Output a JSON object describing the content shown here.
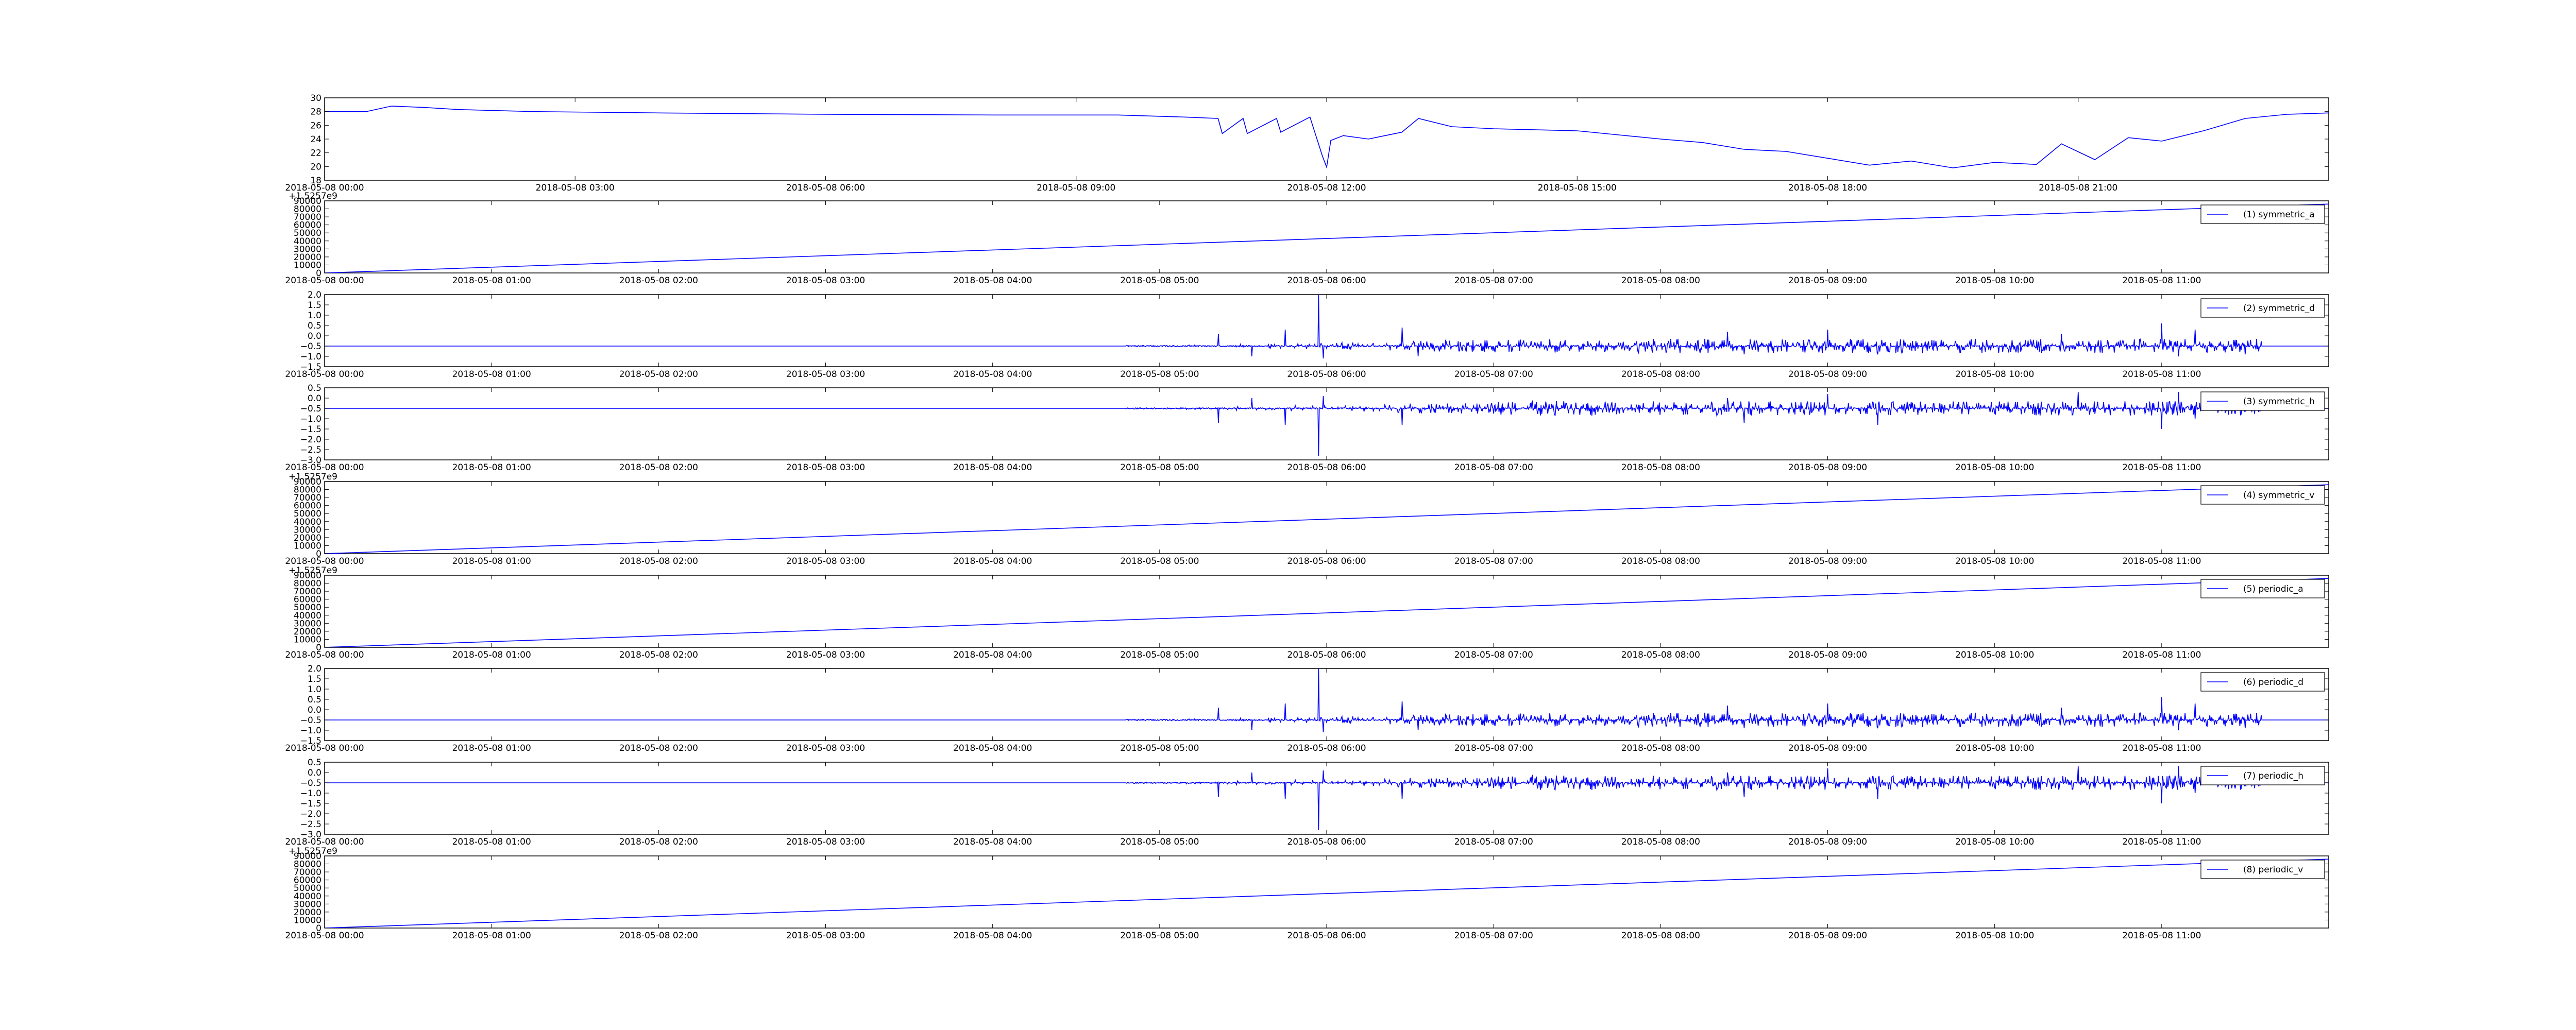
{
  "figure": {
    "background": "#ffffff",
    "line_color": "#0000ff"
  },
  "chart_data": [
    {
      "type": "line",
      "title": "",
      "xlabel": "",
      "ylabel": "",
      "ylim": [
        18,
        30
      ],
      "y_ticks": [
        "30",
        "28",
        "26",
        "24",
        "22",
        "20",
        "18"
      ],
      "x_ticks": [
        "2018-05-08 00:00",
        "2018-05-08 03:00",
        "2018-05-08 06:00",
        "2018-05-08 09:00",
        "2018-05-08 12:00",
        "2018-05-08 15:00",
        "2018-05-08 18:00",
        "2018-05-08 21:00"
      ],
      "x_range_hours": [
        0,
        24
      ],
      "offset_text": "",
      "legend": "",
      "series": [
        {
          "x": [
            0,
            0.5,
            0.8,
            1.2,
            1.6,
            2.5,
            4,
            6,
            8,
            9.5,
            10.3,
            10.7,
            10.75,
            11.0,
            11.05,
            11.4,
            11.45,
            11.8,
            11.95,
            12.0,
            12.05,
            12.2,
            12.5,
            12.9,
            13.1,
            13.5,
            14,
            15,
            15.5,
            16,
            16.5,
            17,
            17.5,
            18,
            18.5,
            19,
            19.5,
            20,
            20.5,
            20.8,
            21.2,
            21.6,
            22,
            22.5,
            23,
            23.5,
            24
          ],
          "values": [
            28,
            28,
            28.8,
            28.6,
            28.3,
            28.0,
            27.8,
            27.6,
            27.5,
            27.5,
            27.2,
            27.0,
            24.8,
            27.0,
            24.8,
            27.0,
            25.0,
            27.2,
            21.5,
            19.9,
            23.8,
            24.5,
            24.0,
            25.0,
            27.0,
            25.8,
            25.5,
            25.2,
            24.6,
            24.0,
            23.5,
            22.5,
            22.2,
            21.2,
            20.2,
            20.8,
            19.8,
            20.6,
            20.3,
            23.3,
            21.0,
            24.2,
            23.7,
            25.2,
            27.0,
            27.6,
            27.8
          ]
        }
      ]
    },
    {
      "type": "line",
      "title": "",
      "xlabel": "",
      "ylabel": "",
      "ylim": [
        0,
        90000
      ],
      "y_ticks": [
        "90000",
        "80000",
        "70000",
        "60000",
        "50000",
        "40000",
        "30000",
        "20000",
        "10000",
        "0"
      ],
      "x_ticks": [
        "2018-05-08 00:00",
        "2018-05-08 01:00",
        "2018-05-08 02:00",
        "2018-05-08 03:00",
        "2018-05-08 04:00",
        "2018-05-08 05:00",
        "2018-05-08 06:00",
        "2018-05-08 07:00",
        "2018-05-08 08:00",
        "2018-05-08 09:00",
        "2018-05-08 10:00",
        "2018-05-08 11:00"
      ],
      "x_range_hours": [
        0,
        12
      ],
      "offset_text": "+1.5257e9",
      "legend": "top-right",
      "series": [
        {
          "name": "(1) symmetric_a",
          "x": [
            0,
            12
          ],
          "values": [
            0,
            86000
          ]
        }
      ]
    },
    {
      "type": "line",
      "title": "",
      "xlabel": "",
      "ylabel": "",
      "ylim": [
        -1.5,
        2.0
      ],
      "y_ticks": [
        "2.0",
        "1.5",
        "1.0",
        "0.5",
        "0.0",
        "−0.5",
        "−1.0",
        "−1.5"
      ],
      "x_ticks": [
        "2018-05-08 00:00",
        "2018-05-08 01:00",
        "2018-05-08 02:00",
        "2018-05-08 03:00",
        "2018-05-08 04:00",
        "2018-05-08 05:00",
        "2018-05-08 06:00",
        "2018-05-08 07:00",
        "2018-05-08 08:00",
        "2018-05-08 09:00",
        "2018-05-08 10:00",
        "2018-05-08 11:00"
      ],
      "x_range_hours": [
        0,
        12
      ],
      "offset_text": "",
      "legend": "top-right",
      "series": [
        {
          "name": "(2) symmetric_d",
          "baseline": -0.5,
          "spikes": [
            [
              5.35,
              0.1
            ],
            [
              5.55,
              -1.0
            ],
            [
              5.75,
              0.3
            ],
            [
              5.95,
              2.0
            ],
            [
              5.98,
              -1.1
            ],
            [
              6.45,
              0.4
            ],
            [
              6.55,
              -1.0
            ],
            [
              8.4,
              0.2
            ],
            [
              8.5,
              -0.9
            ],
            [
              9.0,
              0.3
            ],
            [
              9.3,
              -0.9
            ],
            [
              10.4,
              0.1
            ],
            [
              11.0,
              0.6
            ],
            [
              11.1,
              -1.0
            ],
            [
              11.2,
              0.3
            ],
            [
              11.5,
              -0.9
            ]
          ],
          "noise_start": 4.8,
          "noise_end": 11.6,
          "noise_amp": 0.35,
          "seed": 7
        }
      ]
    },
    {
      "type": "line",
      "title": "",
      "xlabel": "",
      "ylabel": "",
      "ylim": [
        -3.0,
        0.5
      ],
      "y_ticks": [
        "0.5",
        "0.0",
        "−0.5",
        "−1.0",
        "−1.5",
        "−2.0",
        "−2.5",
        "−3.0"
      ],
      "x_ticks": [
        "2018-05-08 00:00",
        "2018-05-08 01:00",
        "2018-05-08 02:00",
        "2018-05-08 03:00",
        "2018-05-08 04:00",
        "2018-05-08 05:00",
        "2018-05-08 06:00",
        "2018-05-08 07:00",
        "2018-05-08 08:00",
        "2018-05-08 09:00",
        "2018-05-08 10:00",
        "2018-05-08 11:00"
      ],
      "x_range_hours": [
        0,
        12
      ],
      "offset_text": "",
      "legend": "top-right",
      "series": [
        {
          "name": "(3) symmetric_h",
          "baseline": -0.5,
          "spikes": [
            [
              5.35,
              -1.2
            ],
            [
              5.55,
              0.0
            ],
            [
              5.75,
              -1.3
            ],
            [
              5.95,
              -2.8
            ],
            [
              5.98,
              0.1
            ],
            [
              6.45,
              -1.3
            ],
            [
              8.4,
              0.0
            ],
            [
              8.5,
              -1.2
            ],
            [
              9.0,
              0.2
            ],
            [
              9.3,
              -1.3
            ],
            [
              10.5,
              0.3
            ],
            [
              11.0,
              -1.5
            ],
            [
              11.1,
              0.3
            ],
            [
              11.2,
              -1.0
            ]
          ],
          "noise_start": 4.8,
          "noise_end": 11.6,
          "noise_amp": 0.35,
          "seed": 11
        }
      ]
    },
    {
      "type": "line",
      "title": "",
      "xlabel": "",
      "ylabel": "",
      "ylim": [
        0,
        90000
      ],
      "y_ticks": [
        "90000",
        "80000",
        "70000",
        "60000",
        "50000",
        "40000",
        "30000",
        "20000",
        "10000",
        "0"
      ],
      "x_ticks": [
        "2018-05-08 00:00",
        "2018-05-08 01:00",
        "2018-05-08 02:00",
        "2018-05-08 03:00",
        "2018-05-08 04:00",
        "2018-05-08 05:00",
        "2018-05-08 06:00",
        "2018-05-08 07:00",
        "2018-05-08 08:00",
        "2018-05-08 09:00",
        "2018-05-08 10:00",
        "2018-05-08 11:00"
      ],
      "x_range_hours": [
        0,
        12
      ],
      "offset_text": "+1.5257e9",
      "legend": "top-right",
      "series": [
        {
          "name": "(4) symmetric_v",
          "x": [
            0,
            12
          ],
          "values": [
            0,
            86000
          ]
        }
      ]
    },
    {
      "type": "line",
      "title": "",
      "xlabel": "",
      "ylabel": "",
      "ylim": [
        0,
        90000
      ],
      "y_ticks": [
        "90000",
        "80000",
        "70000",
        "60000",
        "50000",
        "40000",
        "30000",
        "20000",
        "10000",
        "0"
      ],
      "x_ticks": [
        "2018-05-08 00:00",
        "2018-05-08 01:00",
        "2018-05-08 02:00",
        "2018-05-08 03:00",
        "2018-05-08 04:00",
        "2018-05-08 05:00",
        "2018-05-08 06:00",
        "2018-05-08 07:00",
        "2018-05-08 08:00",
        "2018-05-08 09:00",
        "2018-05-08 10:00",
        "2018-05-08 11:00"
      ],
      "x_range_hours": [
        0,
        12
      ],
      "offset_text": "+1.5257e9",
      "legend": "top-right",
      "series": [
        {
          "name": "(5) periodic_a",
          "x": [
            0,
            12
          ],
          "values": [
            0,
            86000
          ]
        }
      ]
    },
    {
      "type": "line",
      "title": "",
      "xlabel": "",
      "ylabel": "",
      "ylim": [
        -1.5,
        2.0
      ],
      "y_ticks": [
        "2.0",
        "1.5",
        "1.0",
        "0.5",
        "0.0",
        "−0.5",
        "−1.0",
        "−1.5"
      ],
      "x_ticks": [
        "2018-05-08 00:00",
        "2018-05-08 01:00",
        "2018-05-08 02:00",
        "2018-05-08 03:00",
        "2018-05-08 04:00",
        "2018-05-08 05:00",
        "2018-05-08 06:00",
        "2018-05-08 07:00",
        "2018-05-08 08:00",
        "2018-05-08 09:00",
        "2018-05-08 10:00",
        "2018-05-08 11:00"
      ],
      "x_range_hours": [
        0,
        12
      ],
      "offset_text": "",
      "legend": "top-right",
      "series": [
        {
          "name": "(6) periodic_d",
          "baseline": -0.5,
          "spikes": [
            [
              5.35,
              0.1
            ],
            [
              5.55,
              -1.0
            ],
            [
              5.75,
              0.3
            ],
            [
              5.95,
              2.0
            ],
            [
              5.98,
              -1.1
            ],
            [
              6.45,
              0.4
            ],
            [
              6.55,
              -1.0
            ],
            [
              8.4,
              0.2
            ],
            [
              8.5,
              -0.9
            ],
            [
              9.0,
              0.3
            ],
            [
              9.3,
              -0.9
            ],
            [
              10.4,
              0.1
            ],
            [
              11.0,
              0.6
            ],
            [
              11.1,
              -1.0
            ],
            [
              11.2,
              0.3
            ],
            [
              11.5,
              -0.9
            ]
          ],
          "noise_start": 4.8,
          "noise_end": 11.6,
          "noise_amp": 0.35,
          "seed": 7
        }
      ]
    },
    {
      "type": "line",
      "title": "",
      "xlabel": "",
      "ylabel": "",
      "ylim": [
        -3.0,
        0.5
      ],
      "y_ticks": [
        "0.5",
        "0.0",
        "−0.5",
        "−1.0",
        "−1.5",
        "−2.0",
        "−2.5",
        "−3.0"
      ],
      "x_ticks": [
        "2018-05-08 00:00",
        "2018-05-08 01:00",
        "2018-05-08 02:00",
        "2018-05-08 03:00",
        "2018-05-08 04:00",
        "2018-05-08 05:00",
        "2018-05-08 06:00",
        "2018-05-08 07:00",
        "2018-05-08 08:00",
        "2018-05-08 09:00",
        "2018-05-08 10:00",
        "2018-05-08 11:00"
      ],
      "x_range_hours": [
        0,
        12
      ],
      "offset_text": "",
      "legend": "top-right",
      "series": [
        {
          "name": "(7) periodic_h",
          "baseline": -0.5,
          "spikes": [
            [
              5.35,
              -1.2
            ],
            [
              5.55,
              0.0
            ],
            [
              5.75,
              -1.3
            ],
            [
              5.95,
              -2.8
            ],
            [
              5.98,
              0.1
            ],
            [
              6.45,
              -1.3
            ],
            [
              8.4,
              0.0
            ],
            [
              8.5,
              -1.2
            ],
            [
              9.0,
              0.2
            ],
            [
              9.3,
              -1.3
            ],
            [
              10.5,
              0.3
            ],
            [
              11.0,
              -1.5
            ],
            [
              11.1,
              0.3
            ],
            [
              11.2,
              -1.0
            ]
          ],
          "noise_start": 4.8,
          "noise_end": 11.6,
          "noise_amp": 0.35,
          "seed": 11
        }
      ]
    },
    {
      "type": "line",
      "title": "",
      "xlabel": "",
      "ylabel": "",
      "ylim": [
        0,
        90000
      ],
      "y_ticks": [
        "90000",
        "80000",
        "70000",
        "60000",
        "50000",
        "40000",
        "30000",
        "20000",
        "10000",
        "0"
      ],
      "x_ticks": [
        "2018-05-08 00:00",
        "2018-05-08 01:00",
        "2018-05-08 02:00",
        "2018-05-08 03:00",
        "2018-05-08 04:00",
        "2018-05-08 05:00",
        "2018-05-08 06:00",
        "2018-05-08 07:00",
        "2018-05-08 08:00",
        "2018-05-08 09:00",
        "2018-05-08 10:00",
        "2018-05-08 11:00"
      ],
      "x_range_hours": [
        0,
        12
      ],
      "offset_text": "+1.5257e9",
      "legend": "top-right",
      "series": [
        {
          "name": "(8) periodic_v",
          "x": [
            0,
            12
          ],
          "values": [
            0,
            86000
          ]
        }
      ]
    }
  ]
}
